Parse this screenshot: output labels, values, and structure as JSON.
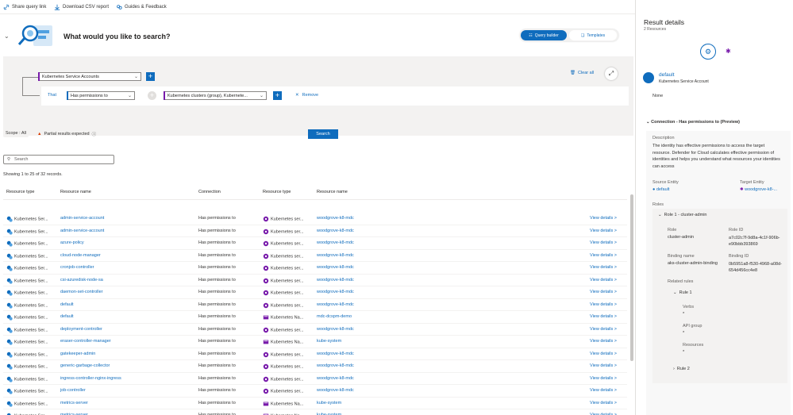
{
  "cmdbar": {
    "share": "Share query link",
    "download": "Download CSV report",
    "guides": "Guides & Feedback"
  },
  "hero": {
    "title": "What would you like to search?",
    "query_builder": "Query builder",
    "templates": "Templates"
  },
  "builder": {
    "entity": "Kubernetes Service Accounts",
    "clear_all": "Clear all",
    "that": "That",
    "relation": "Has permissions to",
    "target": "Kubernetes clusters (group), Kubernete...",
    "remove": "Remove"
  },
  "scope": {
    "label": "Scope :",
    "value": "All"
  },
  "partial": "Partial results expected",
  "search_button": "Search",
  "filter_placeholder": "Search",
  "showing": "Showing 1 to 25 of 32 records.",
  "table": {
    "headers": [
      "Resource type",
      "Resource name",
      "Connection",
      "Resource type",
      "Resource name"
    ],
    "rows": [
      {
        "type": "Kubernetes Ser...",
        "name": "admin-service-account",
        "conn": "Has permissions to",
        "ttype": "Kubernetes ser...",
        "tname": "woodgrove-k8-mdc",
        "ns": false
      },
      {
        "type": "Kubernetes Ser...",
        "name": "admin-service-account",
        "conn": "Has permissions to",
        "ttype": "Kubernetes ser...",
        "tname": "woodgrove-k8-mdc",
        "ns": false
      },
      {
        "type": "Kubernetes Ser...",
        "name": "azure-policy",
        "conn": "Has permissions to",
        "ttype": "Kubernetes ser...",
        "tname": "woodgrove-k8-mdc",
        "ns": false
      },
      {
        "type": "Kubernetes Ser...",
        "name": "cloud-node-manager",
        "conn": "Has permissions to",
        "ttype": "Kubernetes ser...",
        "tname": "woodgrove-k8-mdc",
        "ns": false
      },
      {
        "type": "Kubernetes Ser...",
        "name": "cronjob-controller",
        "conn": "Has permissions to",
        "ttype": "Kubernetes ser...",
        "tname": "woodgrove-k8-mdc",
        "ns": false
      },
      {
        "type": "Kubernetes Ser...",
        "name": "csi-azuredisk-node-sa",
        "conn": "Has permissions to",
        "ttype": "Kubernetes ser...",
        "tname": "woodgrove-k8-mdc",
        "ns": false
      },
      {
        "type": "Kubernetes Ser...",
        "name": "daemon-set-controller",
        "conn": "Has permissions to",
        "ttype": "Kubernetes ser...",
        "tname": "woodgrove-k8-mdc",
        "ns": false
      },
      {
        "type": "Kubernetes Ser...",
        "name": "default",
        "conn": "Has permissions to",
        "ttype": "Kubernetes ser...",
        "tname": "woodgrove-k8-mdc",
        "ns": false
      },
      {
        "type": "Kubernetes Ser...",
        "name": "default",
        "conn": "Has permissions to",
        "ttype": "Kubernetes Na...",
        "tname": "mdc-dcspm-demo",
        "ns": true
      },
      {
        "type": "Kubernetes Ser...",
        "name": "deployment-controller",
        "conn": "Has permissions to",
        "ttype": "Kubernetes ser...",
        "tname": "woodgrove-k8-mdc",
        "ns": false
      },
      {
        "type": "Kubernetes Ser...",
        "name": "eraser-controller-manager",
        "conn": "Has permissions to",
        "ttype": "Kubernetes Na...",
        "tname": "kube-system",
        "ns": true
      },
      {
        "type": "Kubernetes Ser...",
        "name": "gatekeeper-admin",
        "conn": "Has permissions to",
        "ttype": "Kubernetes ser...",
        "tname": "woodgrove-k8-mdc",
        "ns": false
      },
      {
        "type": "Kubernetes Ser...",
        "name": "generic-garbage-collector",
        "conn": "Has permissions to",
        "ttype": "Kubernetes ser...",
        "tname": "woodgrove-k8-mdc",
        "ns": false
      },
      {
        "type": "Kubernetes Ser...",
        "name": "ingress-controller-nginx-ingress",
        "conn": "Has permissions to",
        "ttype": "Kubernetes ser...",
        "tname": "woodgrove-k8-mdc",
        "ns": false
      },
      {
        "type": "Kubernetes Ser...",
        "name": "job-controller",
        "conn": "Has permissions to",
        "ttype": "Kubernetes ser...",
        "tname": "woodgrove-k8-mdc",
        "ns": false
      },
      {
        "type": "Kubernetes Ser...",
        "name": "metrics-server",
        "conn": "Has permissions to",
        "ttype": "Kubernetes Na...",
        "tname": "kube-system",
        "ns": true
      },
      {
        "type": "Kubernetes Ser...",
        "name": "metrics-server",
        "conn": "Has permissions to",
        "ttype": "Kubernetes Na...",
        "tname": "kube-system",
        "ns": true
      }
    ],
    "view_details": "View details >"
  },
  "details": {
    "title": "Result details",
    "count": "2 Resources",
    "entity_name": "default",
    "entity_type": "Kubernetes Service Account",
    "none": "None",
    "connection": "Connection - Has permissions to (Preview)",
    "description_label": "Description",
    "description": "The identity has effective permissions to access the target resource. Defender for Cloud calculates effective permission of identities and helps you understand what resources your identities can access",
    "source_label": "Source Entity",
    "source_value": "default",
    "target_label": "Target Entity",
    "target_value": "woodgrove-k8-...",
    "roles_label": "Roles",
    "role1": "Role 1 - cluster-admin",
    "role_label": "Role",
    "role_value": "cluster-admin",
    "roleid_label": "Role ID",
    "roleid_value": "a7c02c7f-9d8a-4c1f-906b-e90bbb393869",
    "binding_label": "Binding name",
    "binding_value": "aks-cluster-admin-binding",
    "bindingid_label": "Binding ID",
    "bindingid_value": "0b5951a8-f530-4968-a08d-654d456cc4e8",
    "related_rules": "Related rules",
    "rule1": "Rule 1",
    "verbs": "Verbs",
    "verbs_val": "*",
    "apigroup": "API group",
    "apigroup_val": "*",
    "resources": "Resources",
    "resources_val": "*",
    "rule2": "Rule 2"
  },
  "colors": {
    "accent": "#0f6cbd",
    "purple": "#7719aa",
    "warning": "#d83b01"
  }
}
